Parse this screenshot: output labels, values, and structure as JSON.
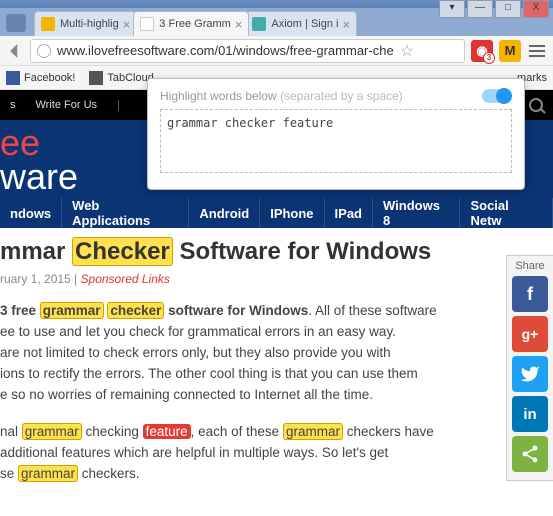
{
  "window": {
    "btn_min": "—",
    "btn_max": "□",
    "btn_close": "X"
  },
  "tabs": [
    {
      "title": "Multi-highlig",
      "fav": "#f4b400"
    },
    {
      "title": "3 Free Gramm",
      "fav": "#888"
    },
    {
      "title": "Axiom | Sign i",
      "fav": "#4aa"
    }
  ],
  "url": "www.ilovefreesoftware.com/01/windows/free-grammar-che",
  "ext_m": "M",
  "bookmarks": {
    "fb": "Facebook!",
    "tc": "TabCloud",
    "mk": "marks"
  },
  "popup": {
    "label": "Highlight words below ",
    "sep": "(separated by a space)",
    "value": "grammar checker feature"
  },
  "sitenav": {
    "item1": "s",
    "item2": "Write For Us"
  },
  "hero": {
    "line1": "ee",
    "line2": "ware"
  },
  "cats": [
    "ndows",
    "Web Applications",
    "Android",
    "IPhone",
    "IPad",
    "Windows 8",
    "Social Netw"
  ],
  "article": {
    "title_pre": "mmar ",
    "title_hl": "Checker",
    "title_post": " Software for Windows",
    "date": "ruary 1, 2015",
    "sep": " | ",
    "spons": "Sponsored Links",
    "p1_a": "3 free ",
    "p1_g": "grammar",
    "p1_b": " ",
    "p1_c": "checker",
    "p1_d": " software for Windows",
    "p1_e": ". All of these software ",
    "p1_f": "ee to use and let you check for grammatical errors in an easy way. ",
    "p1_h": "are not limited to check errors only, but they also provide you with ",
    "p1_i": "ions to rectify the errors. The other cool thing is that you can use them ",
    "p1_j": "e so no worries of remaining connected to Internet all the time.",
    "p2_a": "nal ",
    "p2_g1": "grammar",
    "p2_b": " checking ",
    "p2_f": "feature",
    "p2_c": ", each of these ",
    "p2_g2": "grammar",
    "p2_d": " checkers have ",
    "p2_e": "additional features which are helpful in multiple ways. So let's get ",
    "p2_h": "se ",
    "p2_g3": "grammar",
    "p2_i": " checkers."
  },
  "share": {
    "label": "Share",
    "fb": "f",
    "gp": "g+",
    "tw": "t",
    "li": "in",
    "st": "<"
  }
}
